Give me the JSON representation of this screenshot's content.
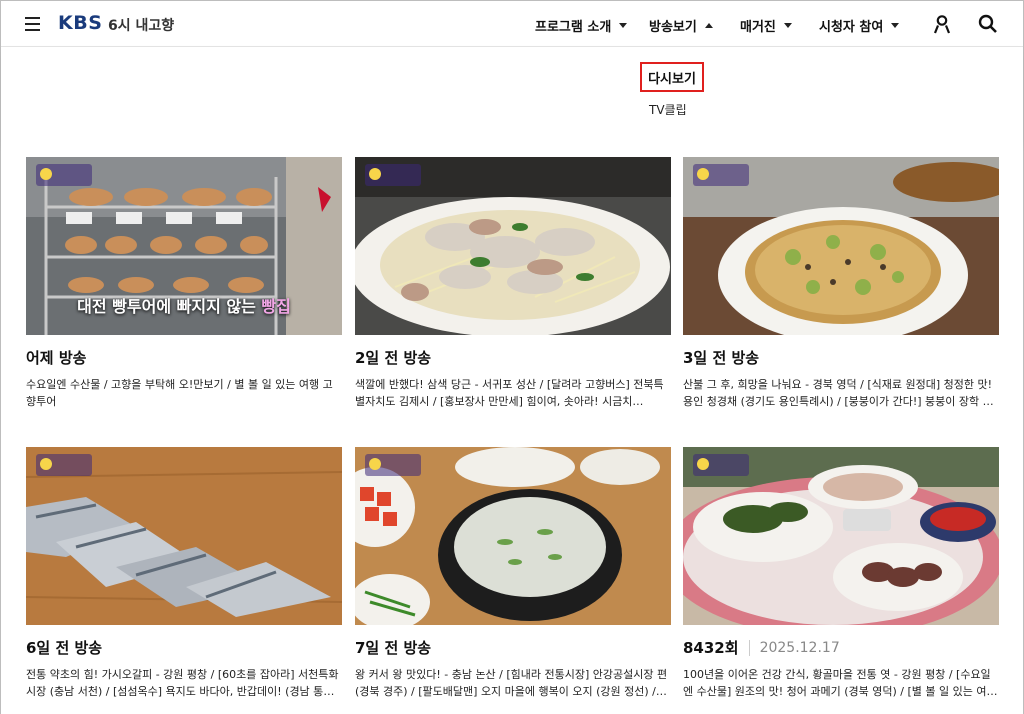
{
  "header": {
    "logo": "KBS",
    "program": "6시 내고향",
    "nav": [
      {
        "label": "프로그램 소개"
      },
      {
        "label": "방송보기"
      },
      {
        "label": "매거진"
      },
      {
        "label": "시청자 참여"
      }
    ],
    "icons": {
      "menu": "hamburger-icon",
      "user": "user-icon",
      "search": "search-icon"
    }
  },
  "submenu": {
    "active": "다시보기",
    "items": [
      "TV클립"
    ]
  },
  "cards": [
    {
      "title": "어제 방송",
      "date": "",
      "desc": "수요일엔 수산물 / 고향을 부탁해 오!만보기 / 별 볼 일 있는 여행 고향투어",
      "caption_pre": "대전 빵투어에 빠지지 않는 ",
      "caption_hl": "빵집"
    },
    {
      "title": "2일 전 방송",
      "date": "",
      "desc": "색깔에 반했다! 삼색 당근 - 서귀포 성산 / [달려라 고향버스] 전북특별자치도 김제시 / [홍보장사 만만세] 힘이여, 솟아라! 시금치…"
    },
    {
      "title": "3일 전 방송",
      "date": "",
      "desc": "산불 그 후, 희망을 나눠요 - 경북 영덕 / [식재료 원정대] 청정한 맛! 용인 청경채 (경기도 용인특례시) / [붕붕이가 간다!] 붕붕이 장학 퀴즈 (전남…"
    },
    {
      "title": "6일 전 방송",
      "date": "",
      "desc": "전통 약초의 힘! 가시오갈피 - 강원 평창 / [60초를 잡아라] 서천특화시장 (충남 서천) / [섬섬옥수] 욕지도 바다아, 반갑데이! (경남 통영) /…"
    },
    {
      "title": "7일 전 방송",
      "date": "",
      "desc": "왕 커서 왕 맛있다! - 충남 논산 / [힘내라 전통시장] 안강공설시장 편 (경북 경주) / [팔도배달맨] 오지 마을에 행복이 오지 (강원 정선) /…"
    },
    {
      "title": "8432회",
      "date": "2025.12.17",
      "desc": "100년을 이어온 건강 간식, 황골마을 전통 엿 - 강원 평창 / [수요일엔 수산물] 원조의 맛! 청어 과메기 (경북 영덕) / [별 볼 일 있는 여행…"
    }
  ],
  "colors": {
    "logo": "#1a3b7c",
    "active_border": "#e0201e"
  }
}
